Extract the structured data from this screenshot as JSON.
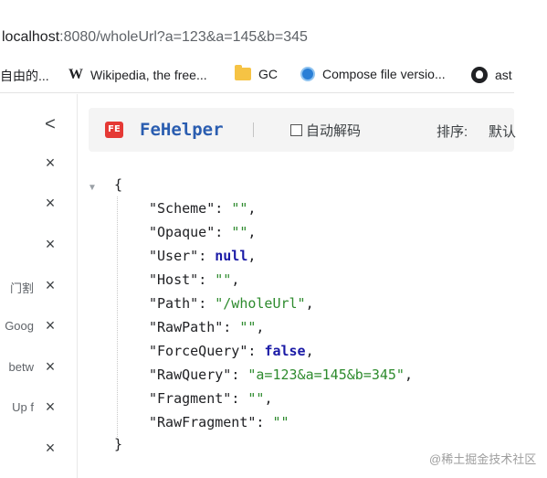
{
  "address_bar": {
    "host": "localhost",
    "rest": ":8080/wholeUrl?a=123&a=145&b=345"
  },
  "bookmarks": [
    {
      "label": "自由的...",
      "icon": "none"
    },
    {
      "label": "Wikipedia, the free...",
      "icon": "wikipedia-icon",
      "glyph": "W"
    },
    {
      "label": "GC",
      "icon": "folder-icon"
    },
    {
      "label": "Compose file versio...",
      "icon": "compose-icon"
    },
    {
      "label": "ast",
      "icon": "github-icon"
    }
  ],
  "sidebar": {
    "collapse_glyph": "<",
    "close_glyph": "×",
    "items": [
      {
        "label": ""
      },
      {
        "label": ""
      },
      {
        "label": ""
      },
      {
        "label": "门割"
      },
      {
        "label": "Goog"
      },
      {
        "label": "betw"
      },
      {
        "label": "Up f"
      },
      {
        "label": ""
      }
    ]
  },
  "toolbar": {
    "logo_text": "FE",
    "title": "FeHelper",
    "auto_decode_label": "自动解码",
    "auto_decode_checked": false,
    "sort_label": "排序:",
    "sort_value": "默认"
  },
  "json_view": {
    "open_brace": "{",
    "close_brace": "}",
    "fields": [
      {
        "key": "\"Scheme\"",
        "value": "\"\"",
        "type": "string"
      },
      {
        "key": "\"Opaque\"",
        "value": "\"\"",
        "type": "string"
      },
      {
        "key": "\"User\"",
        "value": "null",
        "type": "keyword"
      },
      {
        "key": "\"Host\"",
        "value": "\"\"",
        "type": "string"
      },
      {
        "key": "\"Path\"",
        "value": "\"/wholeUrl\"",
        "type": "string"
      },
      {
        "key": "\"RawPath\"",
        "value": "\"\"",
        "type": "string"
      },
      {
        "key": "\"ForceQuery\"",
        "value": "false",
        "type": "keyword"
      },
      {
        "key": "\"RawQuery\"",
        "value": "\"a=123&a=145&b=345\"",
        "type": "string"
      },
      {
        "key": "\"Fragment\"",
        "value": "\"\"",
        "type": "string"
      },
      {
        "key": "\"RawFragment\"",
        "value": "\"\"",
        "type": "string"
      }
    ]
  },
  "watermark": "@稀土掘金技术社区",
  "colors": {
    "string": "#2e8b2e",
    "keyword": "#1a1aa6",
    "fehelper_title": "#2a5db0",
    "fe_logo": "#e53935"
  }
}
